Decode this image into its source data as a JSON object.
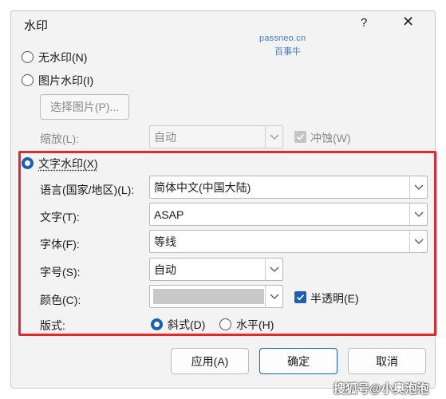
{
  "title": "水印",
  "help_label": "?",
  "close_label": "✕",
  "overlay": {
    "site": "passneo.cn",
    "site_cn": "百事牛",
    "footer_tag": "搜狐号@小奥泡泡"
  },
  "options": {
    "none_label": "无水印(N)",
    "picture_label": "图片水印(I)",
    "text_label": "文字水印(X)"
  },
  "picture": {
    "select_button": "选择图片(P)...",
    "scale_label": "缩放(L):",
    "scale_value": "自动",
    "washout_label": "冲蚀(W)"
  },
  "text_section": {
    "language_label": "语言(国家/地区)(L):",
    "language_value": "简体中文(中国大陆)",
    "text_label": "文字(T):",
    "text_value": "ASAP",
    "font_label": "字体(F):",
    "font_value": "等线",
    "size_label": "字号(S):",
    "size_value": "自动",
    "color_label": "颜色(C):",
    "color_value": "#c8c8c8",
    "semitransparent_label": "半透明(E)",
    "layout_label": "版式:",
    "diagonal_label": "斜式(D)",
    "horizontal_label": "水平(H)"
  },
  "selected": {
    "watermark_type": "text",
    "layout": "diagonal",
    "semitransparent": true,
    "washout": true
  },
  "buttons": {
    "apply": "应用(A)",
    "ok": "确定",
    "cancel": "取消"
  }
}
